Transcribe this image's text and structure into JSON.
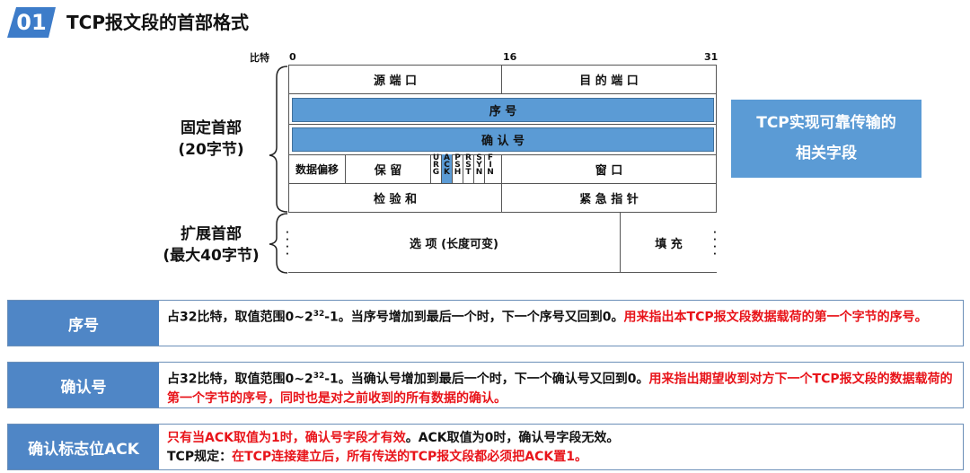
{
  "header": {
    "badge": "01",
    "title": "TCP报文段的首部格式"
  },
  "diagram": {
    "bits_label": "比特",
    "bit_marks": [
      "0",
      "16",
      "31"
    ],
    "fixed_header_label": [
      "固定首部",
      "(20字节)"
    ],
    "ext_header_label": [
      "扩展首部",
      "(最大40字节)"
    ],
    "fields": {
      "src_port": "源 端 口",
      "dst_port": "目 的 端 口",
      "seq": "序 号",
      "ack_num": "确 认 号",
      "data_offset": "数据偏移",
      "reserved": "保 留",
      "window": "窗 口",
      "checksum": "检 验 和",
      "urgent": "紧 急 指 针",
      "options": "选 项 (长度可变)",
      "padding": "填 充"
    },
    "flags": [
      "URG",
      "ACK",
      "PSH",
      "RST",
      "SYN",
      "FIN"
    ],
    "highlighted_flag": "ACK"
  },
  "callout": {
    "line1": "TCP实现可靠传输的",
    "line2": "相关字段"
  },
  "rows": [
    {
      "label": "序号",
      "p1": "占32比特，取值范围0~2",
      "sup": "32",
      "p2": "-1。当序号增加到最后一个时，下一个序号又回到0。",
      "red": "用来指出本TCP报文段数据载荷的第一个字节的序号。"
    },
    {
      "label": "确认号",
      "p1": "占32比特，取值范围0~2",
      "sup": "32",
      "p2": "-1。当确认号增加到最后一个时，下一个确认号又回到0。",
      "red": "用来指出期望收到对方下一个TCP报文段的数据载荷的第一个字节的序号，同时也是对之前收到的所有数据的确认。"
    },
    {
      "label": "确认标志位ACK",
      "red1": "只有当ACK取值为1时，确认号字段才有效",
      "black1": "。ACK取值为0时，确认号字段无效。",
      "black2": "TCP规定：",
      "red2": "在TCP连接建立后，所有传送的TCP报文段都必须把ACK置1。"
    }
  ],
  "colors": {
    "accent": "#5b9bd5",
    "label_bg": "#4f86c6",
    "badge": "#3d7cc9",
    "emphasis": "#e8141a"
  }
}
